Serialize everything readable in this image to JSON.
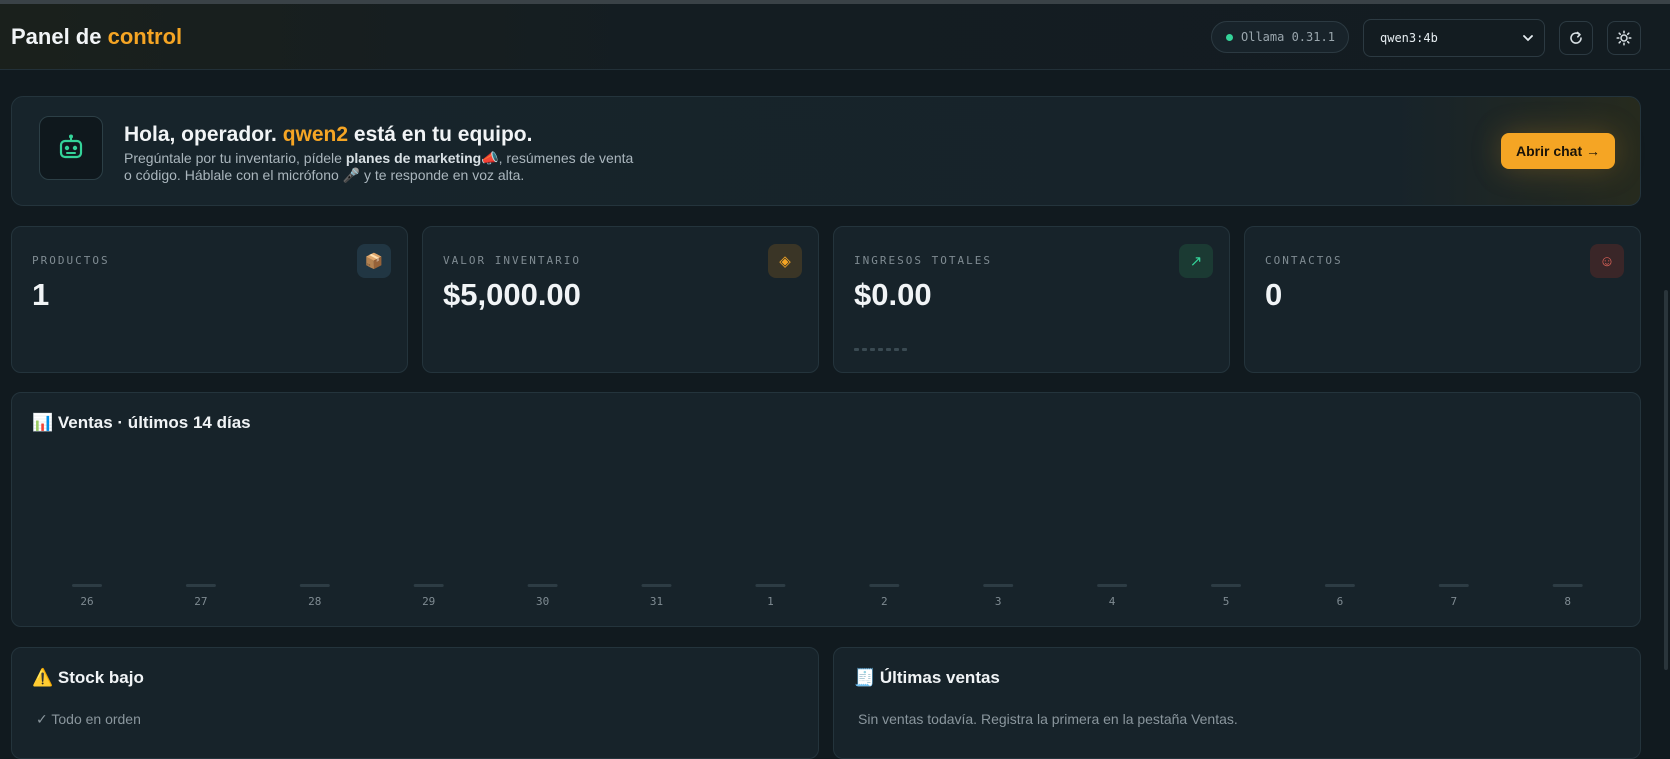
{
  "header": {
    "title_main": "Panel de",
    "title_accent": "control",
    "ollama_status": "Ollama 0.31.1",
    "status_color": "#34d399",
    "model_selected": "qwen3:4b",
    "refresh_icon": "refresh-icon",
    "theme_icon": "sun-icon"
  },
  "hero": {
    "icon": "robot-icon",
    "greeting": "Hola, operador.",
    "assistant_name": "qwen2",
    "greeting_tail": "está en tu equipo.",
    "sub_1": "Pregúntale por tu inventario, pídele",
    "sub_bold": "planes de marketing",
    "sub_2": "📣, resúmenes de venta o código. Háblale con el micrófono 🎤 y te responde en voz alta.",
    "chat_button": "Abrir chat →"
  },
  "stats": [
    {
      "label": "PRODUCTOS",
      "value": "1",
      "icon": "📦",
      "icon_name": "box-icon"
    },
    {
      "label": "VALOR INVENTARIO",
      "value": "$5,000.00",
      "icon": "◈",
      "icon_name": "diamond-icon"
    },
    {
      "label": "INGRESOS TOTALES",
      "value": "$0.00",
      "icon": "↗",
      "icon_name": "trend-up-icon"
    },
    {
      "label": "CONTACTOS",
      "value": "0",
      "icon": "☺",
      "icon_name": "smile-icon"
    }
  ],
  "colors": {
    "accent": "#f5a524",
    "background": "#111a1f",
    "card": "#17232a"
  },
  "sales_chart": {
    "title": "📊 Ventas · últimos 14 días"
  },
  "chart_data": {
    "type": "bar",
    "title": "📊 Ventas · últimos 14 días",
    "categories": [
      "26",
      "27",
      "28",
      "29",
      "30",
      "31",
      "1",
      "2",
      "3",
      "4",
      "5",
      "6",
      "7",
      "8"
    ],
    "values": [
      0,
      0,
      0,
      0,
      0,
      0,
      0,
      0,
      0,
      0,
      0,
      0,
      0,
      0
    ],
    "ylim": [
      0,
      1
    ],
    "grid": false
  },
  "low_stock": {
    "title": "⚠️ Stock bajo",
    "message": "✓ Todo en orden"
  },
  "recent_sales": {
    "title": "🧾 Últimas ventas",
    "message": "Sin ventas todavía. Registra la primera en la pestaña Ventas."
  }
}
